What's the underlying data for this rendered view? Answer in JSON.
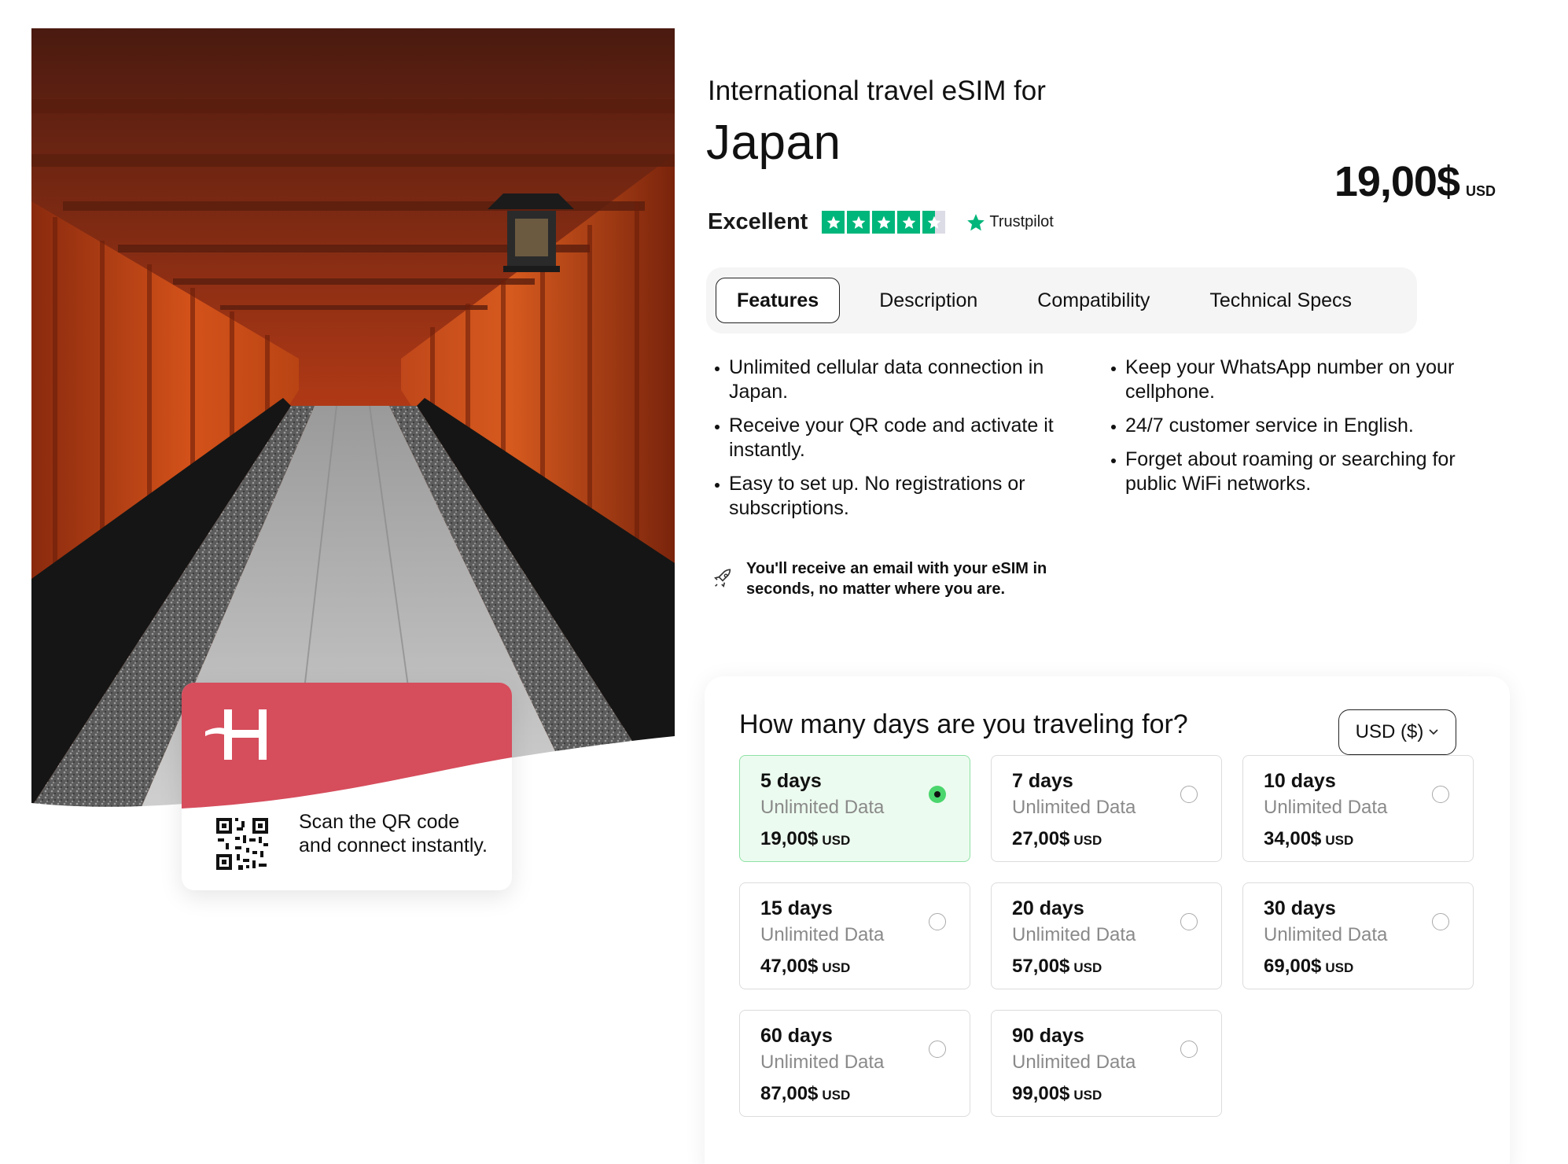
{
  "product": {
    "pretitle": "International travel eSIM for",
    "title": "Japan",
    "price": "19,00$",
    "currency_code": "USD"
  },
  "rating": {
    "label": "Excellent",
    "stars": 4.5,
    "provider": "Trustpilot",
    "star_color": "#00b67a"
  },
  "tabs": [
    {
      "label": "Features",
      "active": true
    },
    {
      "label": "Description",
      "active": false
    },
    {
      "label": "Compatibility",
      "active": false
    },
    {
      "label": "Technical Specs",
      "active": false
    }
  ],
  "features": {
    "left": [
      "Unlimited cellular data connection in Japan.",
      "Receive your QR code and activate it instantly.",
      "Easy to set up. No registrations or subscriptions."
    ],
    "right": [
      "Keep your WhatsApp number on your cellphone.",
      "24/7 customer service in English.",
      "Forget about roaming or searching for public WiFi networks."
    ]
  },
  "notice": {
    "icon": "rocket-icon",
    "text": "You'll receive an email with your eSIM in seconds, no matter where you are."
  },
  "card": {
    "scan_text": "Scan the QR code and connect instantly.",
    "brand_color": "#d64d5c"
  },
  "selector": {
    "question": "How many days are you traveling for?",
    "currency_select": "USD ($)",
    "options": [
      {
        "days": "5 days",
        "sub": "Unlimited Data",
        "price": "19,00$",
        "unit": "USD",
        "selected": true
      },
      {
        "days": "7 days",
        "sub": "Unlimited Data",
        "price": "27,00$",
        "unit": "USD",
        "selected": false
      },
      {
        "days": "10 days",
        "sub": "Unlimited Data",
        "price": "34,00$",
        "unit": "USD",
        "selected": false
      },
      {
        "days": "15 days",
        "sub": "Unlimited Data",
        "price": "47,00$",
        "unit": "USD",
        "selected": false
      },
      {
        "days": "20 days",
        "sub": "Unlimited Data",
        "price": "57,00$",
        "unit": "USD",
        "selected": false
      },
      {
        "days": "30 days",
        "sub": "Unlimited Data",
        "price": "69,00$",
        "unit": "USD",
        "selected": false
      },
      {
        "days": "60 days",
        "sub": "Unlimited Data",
        "price": "87,00$",
        "unit": "USD",
        "selected": false
      },
      {
        "days": "90 days",
        "sub": "Unlimited Data",
        "price": "99,00$",
        "unit": "USD",
        "selected": false
      }
    ],
    "selected_color": "#4ad66d"
  }
}
